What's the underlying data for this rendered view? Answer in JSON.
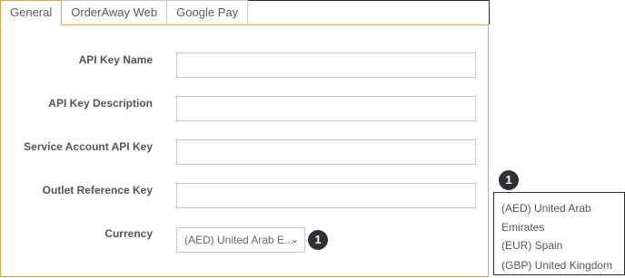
{
  "tabs": [
    {
      "label": "General",
      "active": true
    },
    {
      "label": "OrderAway Web",
      "active": false
    },
    {
      "label": "Google Pay",
      "active": false
    }
  ],
  "form": {
    "api_key_name": {
      "label": "API Key Name",
      "value": ""
    },
    "api_key_description": {
      "label": "API Key Description",
      "value": ""
    },
    "service_account_api_key": {
      "label": "Service Account API Key",
      "value": ""
    },
    "outlet_reference_key": {
      "label": "Outlet Reference Key",
      "value": ""
    },
    "currency": {
      "label": "Currency",
      "selected": "(AED) United Arab E..."
    }
  },
  "callouts": {
    "currency_badge": "1",
    "dropdown_badge": "1"
  },
  "currency_options": [
    {
      "label": "(AED) United Arab\nEmirates"
    },
    {
      "label": "(EUR) Spain"
    },
    {
      "label": "(GBP) United Kingdom"
    }
  ],
  "colors": {
    "accent_border": "#e9a23b",
    "badge_bg": "#2f3136"
  },
  "icons": {
    "select_chevron": "chevron-down-icon"
  }
}
